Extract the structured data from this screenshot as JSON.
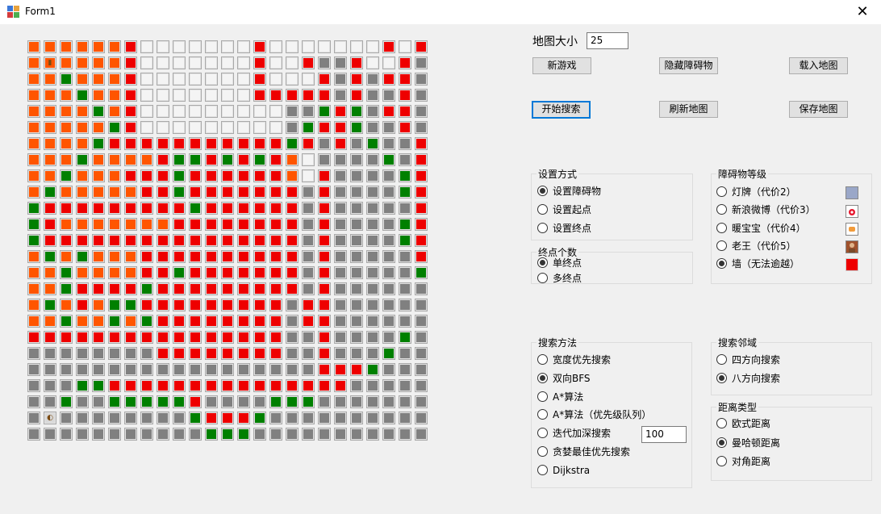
{
  "window": {
    "title": "Form1",
    "close_glyph": "✕"
  },
  "map_size": {
    "label": "地图大小",
    "value": "25"
  },
  "buttons": {
    "new_game": "新游戏",
    "hide_obstacles": "隐藏障碍物",
    "load_map": "载入地图",
    "start_search": "开始搜索",
    "refresh_map": "刷新地图",
    "save_map": "保存地图"
  },
  "setting_mode": {
    "title": "设置方式",
    "options": [
      "设置障碍物",
      "设置起点",
      "设置终点"
    ],
    "selected": 0
  },
  "endpoint_count": {
    "title": "终点个数",
    "options": [
      "单终点",
      "多终点"
    ],
    "selected": 0
  },
  "obstacle_level": {
    "title": "障碍物等级",
    "options": [
      "灯牌（代价2）",
      "新浪微博（代价3）",
      "暖宝宝（代价4）",
      "老王（代价5）",
      "墙（无法逾越）"
    ],
    "selected": 4,
    "icons": [
      "billboard-icon",
      "weibo-icon",
      "hand-warmer-icon",
      "laowang-avatar-icon",
      "wall-icon"
    ]
  },
  "search_method": {
    "title": "搜索方法",
    "options": [
      "宽度优先搜索",
      "双向BFS",
      "A*算法",
      "A*算法（优先级队列）",
      "迭代加深搜索",
      "贪婪最佳优先搜索",
      "Dijkstra"
    ],
    "selected": 1,
    "iddfs_limit": "100"
  },
  "search_neighborhood": {
    "title": "搜索邻域",
    "options": [
      "四方向搜索",
      "八方向搜索"
    ],
    "selected": 1
  },
  "distance_type": {
    "title": "距离类型",
    "options": [
      "欧式距离",
      "曼哈顿距离",
      "对角距离"
    ],
    "selected": 1
  },
  "colors": {
    "O": "#ff5500",
    "R": "#ee0000",
    "G": "#008000",
    "D": "#808080",
    "L": "#f4f4f4"
  },
  "grid": {
    "size": 25,
    "rows": [
      "OOOOOOR.......R.......RLRR",
      "OSOOOOR.......R..RDDRLLRD",
      "OOGOOOR.......R...RDRDRRD",
      "OOOGOOR.......RRRRRDRDDRD",
      "OOOOGOR.........DDGRGDRRD",
      "OOOOOGR.........DGRRGDDRD",
      "OOOOGRRRRRRRRRRRGRDRDGDDRD",
      "OOOGOOOORGGRGRGRO.DDDDGDRD",
      "OOGOOORRRGRRRRRRO.RDDDDGRD",
      "OGOOOOORRGRRRRRRRDRDDDDGRD",
      "GRRRRRRRRRGRRRRRRDRDDDDDRD",
      "GROOOOOOORRRRRRRRDRDDDDGRD",
      "GRRRRRRRRRRRRRRRRDRDDDDGRD",
      "OGOGOOORRRRRRRRRRDRDDDDDRD",
      "OOGOOOORRGRRRRRRRDRDDDDDGD",
      "OOGRRRRGRRRRRRRRRDRDDDDDDG",
      "OGOROGGRRRRRRRRRDRRDDDDDDG",
      "OOGOOGOGRRRRRRRRDRRDDDDDDG",
      "RRRRRRRRRRRRRRRRDDRDDDDGDD",
      "DDDDDDDDRRRRRRRRDDRDDDGDDD",
      "DDDDDDDDDDDDDDDDDDRRRGDDDD",
      "DDDGGRRRRRRRRRRRRRRRDDDDDD",
      "DDGDDGGGGGRDDDDGGGDDDDDDDD",
      "DWDDDDDDDDGRRRGDDDDDDDDDDD",
      "DDDDDDDDDDDGGGDDDDDDDDDDDD"
    ]
  }
}
